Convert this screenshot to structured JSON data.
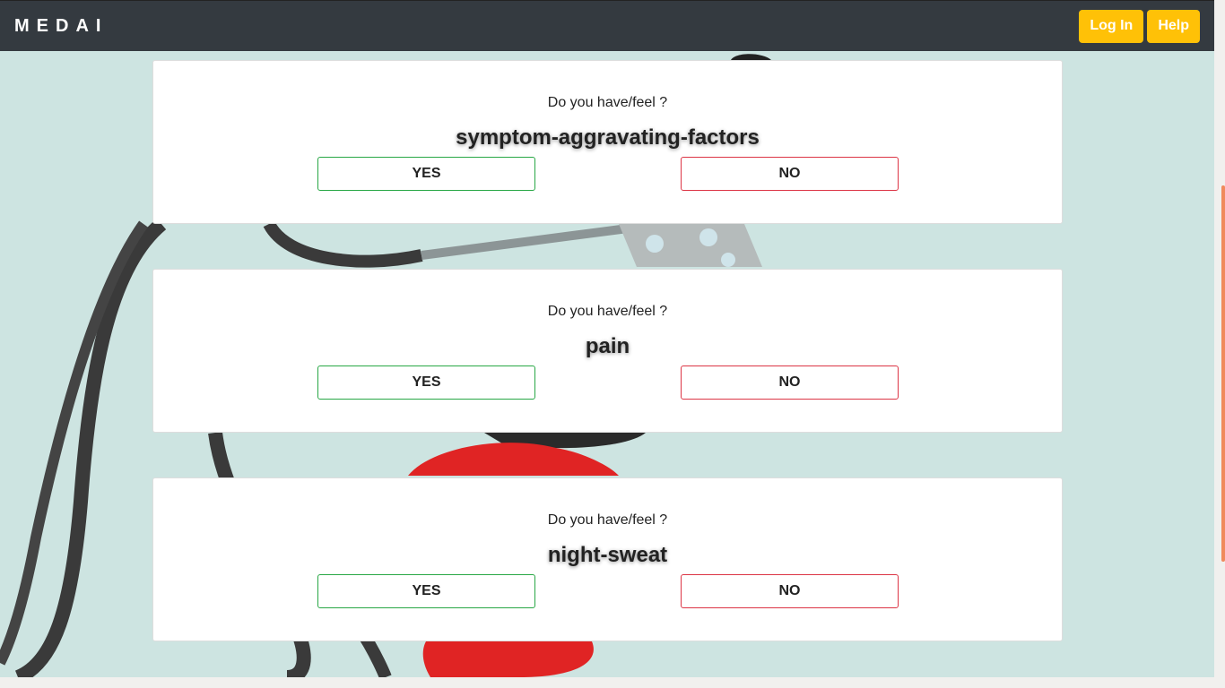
{
  "navbar": {
    "brand": "MEDAI",
    "login_label": "Log In",
    "help_label": "Help"
  },
  "cards": [
    {
      "question": "Do you have/feel ?",
      "symptom": "symptom-aggravating-factors",
      "yes_label": "YES",
      "no_label": "NO"
    },
    {
      "question": "Do you have/feel ?",
      "symptom": "pain",
      "yes_label": "YES",
      "no_label": "NO"
    },
    {
      "question": "Do you have/feel ?",
      "symptom": "night-sweat",
      "yes_label": "YES",
      "no_label": "NO"
    }
  ],
  "colors": {
    "navbar": "#343a40",
    "accent": "#ffc107",
    "yes_border": "#28a745",
    "no_border": "#dc3545",
    "background": "#cde4e1"
  }
}
